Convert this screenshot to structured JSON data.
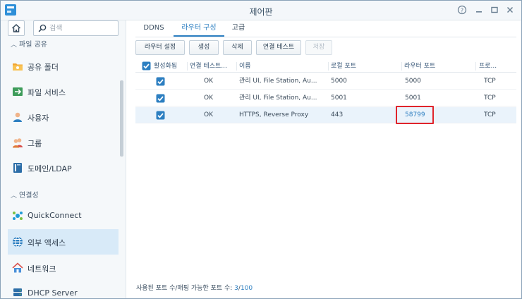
{
  "window": {
    "title": "제어판",
    "controls": [
      "help-icon",
      "minimize-icon",
      "maximize-icon",
      "close-icon"
    ]
  },
  "sidebar": {
    "search_placeholder": "검색",
    "sections": [
      {
        "label": "파일 공유",
        "items": [
          {
            "label": "공유 폴더",
            "icon": "shared-folder-icon"
          },
          {
            "label": "파일 서비스",
            "icon": "file-services-icon"
          },
          {
            "label": "사용자",
            "icon": "user-icon"
          },
          {
            "label": "그룹",
            "icon": "group-icon"
          },
          {
            "label": "도메인/LDAP",
            "icon": "domain-ldap-icon"
          }
        ]
      },
      {
        "label": "연결성",
        "items": [
          {
            "label": "QuickConnect",
            "icon": "quickconnect-icon"
          },
          {
            "label": "외부 액세스",
            "icon": "external-access-icon",
            "active": true
          },
          {
            "label": "네트워크",
            "icon": "network-icon"
          },
          {
            "label": "DHCP Server",
            "icon": "dhcp-server-icon"
          }
        ]
      }
    ]
  },
  "tabs": [
    {
      "label": "DDNS"
    },
    {
      "label": "라우터 구성",
      "active": true
    },
    {
      "label": "고급"
    }
  ],
  "toolbar": {
    "buttons": [
      {
        "label": "라우터 설정"
      },
      {
        "label": "생성"
      },
      {
        "label": "삭제"
      },
      {
        "label": "연결 테스트"
      },
      {
        "label": "저장",
        "disabled": true
      }
    ]
  },
  "grid": {
    "columns": [
      "활성화됨",
      "연결 테스트...",
      "이름",
      "로컬 포트",
      "라우터 포트",
      "프로..."
    ],
    "rows": [
      {
        "enabled": true,
        "test": "OK",
        "name": "관리 UI, File Station, Au...",
        "local_port": "5000",
        "router_port": "5000",
        "protocol": "TCP"
      },
      {
        "enabled": true,
        "test": "OK",
        "name": "관리 UI, File Station, Au...",
        "local_port": "5001",
        "router_port": "5001",
        "protocol": "TCP"
      },
      {
        "enabled": true,
        "test": "OK",
        "name": "HTTPS, Reverse Proxy",
        "local_port": "443",
        "router_port": "58799",
        "protocol": "TCP",
        "selected": true,
        "highlighted": true
      }
    ]
  },
  "footer": {
    "label": "사용된 포트 수/매핑 가능한 포트 수:",
    "used": "3",
    "separator": "/",
    "total": "100"
  },
  "colors": {
    "accent": "#2d7fc1",
    "highlight": "#e0242b",
    "selected_row": "#eaf3fb",
    "active_nav": "#d8eaf8"
  }
}
